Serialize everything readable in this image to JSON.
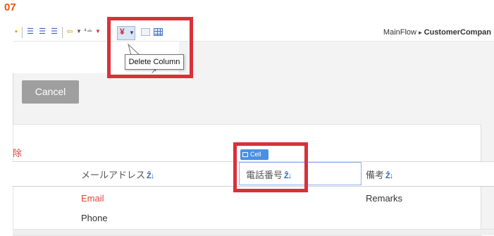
{
  "step_label": "07",
  "breadcrumb": {
    "parent": "MainFlow",
    "separator": "▸",
    "current": "CustomerCompan"
  },
  "tooltip": "Delete Column",
  "cancel_label": "Cancel",
  "delete_label": "除",
  "cell_badge": "Cell",
  "columns": [
    {
      "label": "メールアドレス",
      "sort_icon": "sort-az-icon"
    },
    {
      "label": "電話番号",
      "sort_icon": "sort-az-icon"
    },
    {
      "label": "備考",
      "sort_icon": "sort-az-icon"
    }
  ],
  "rows": [
    {
      "email": "Email",
      "remarks": "Remarks"
    },
    {
      "email": "Phone"
    }
  ],
  "colors": {
    "highlight": "#d9303a",
    "step": "#e8550c",
    "badge": "#4a90e2",
    "email_text": "#e0463a"
  }
}
